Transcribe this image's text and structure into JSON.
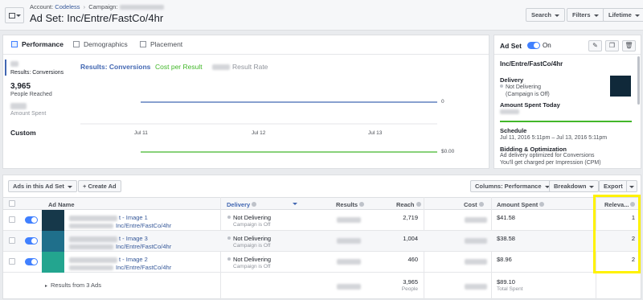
{
  "header": {
    "account_label": "Account:",
    "account_name": "Codeless",
    "campaign_label": "Campaign:",
    "title": "Ad Set: Inc/Entre/FastCo/4hr",
    "search_label": "Search",
    "filters_label": "Filters",
    "date_label": "Lifetime"
  },
  "tabs": [
    "Performance",
    "Demographics",
    "Placement"
  ],
  "stats": {
    "results_label": "Results: Conversions",
    "results_value": "3,965",
    "reached_label": "People Reached",
    "spent_label": "Amount Spent",
    "custom_label": "Custom"
  },
  "chart": {
    "legend": [
      "Results: Conversions",
      "Cost per Result",
      "Result Rate"
    ],
    "legend_colors": [
      "#4267b2",
      "#42b72a",
      "#90949c"
    ],
    "x_ticks": [
      "Jul 11",
      "Jul 12",
      "Jul 13"
    ],
    "y_top_label": "0",
    "y_bottom_label": "$0.00",
    "chart_data": {
      "type": "line",
      "x": [
        "Jul 11",
        "Jul 12",
        "Jul 13"
      ],
      "series": [
        {
          "name": "Results: Conversions",
          "values": [
            0,
            0,
            0
          ]
        },
        {
          "name": "Cost per Result",
          "values": [
            0,
            0,
            0
          ]
        }
      ]
    }
  },
  "adset_panel": {
    "label": "Ad Set",
    "status": "On",
    "name": "Inc/Entre/FastCo/4hr",
    "delivery_label": "Delivery",
    "delivery_value": "Not Delivering",
    "delivery_note": "(Campaign is Off)",
    "spent_today_label": "Amount Spent Today",
    "schedule_label": "Schedule",
    "schedule_value": "Jul 11, 2016 5:11pm – Jul 13, 2016 5:11pm",
    "bidding_label": "Bidding & Optimization",
    "bidding_line1": "Ad delivery optimized for Conversions",
    "bidding_line2": "You'll get charged per Impression (CPM)"
  },
  "table_toolbar": {
    "ads_dropdown": "Ads in this Ad Set",
    "create_ad": "+ Create Ad",
    "columns": "Columns: Performance",
    "breakdown": "Breakdown",
    "export": "Export"
  },
  "columns": [
    "Ad Name",
    "Delivery",
    "Results",
    "Reach",
    "Cost",
    "Amount Spent",
    "Releva..."
  ],
  "rows": [
    {
      "name_suffix": "t - Image 1",
      "adset": "Inc/Entre/FastCo/4hr",
      "delivery": "Not Delivering",
      "delivery_note": "Campaign is Off",
      "reach": "2,719",
      "spent": "$41.58",
      "relevance": "1",
      "thumb_color": "#16384a"
    },
    {
      "name_suffix": "t - Image 3",
      "adset": "Inc/Entre/FastCo/4hr",
      "delivery": "Not Delivering",
      "delivery_note": "Campaign is Off",
      "reach": "1,004",
      "spent": "$38.58",
      "relevance": "2",
      "thumb_color": "#1f6f8b"
    },
    {
      "name_suffix": "t - Image 2",
      "adset": "Inc/Entre/FastCo/4hr",
      "delivery": "Not Delivering",
      "delivery_note": "Campaign is Off",
      "reach": "460",
      "spent": "$8.96",
      "relevance": "2",
      "thumb_color": "#23a58f"
    }
  ],
  "totals": {
    "label": "Results from 3 Ads",
    "reach": "3,965",
    "reach_unit": "People",
    "spent": "$89.10",
    "spent_unit": "Total Spent"
  }
}
